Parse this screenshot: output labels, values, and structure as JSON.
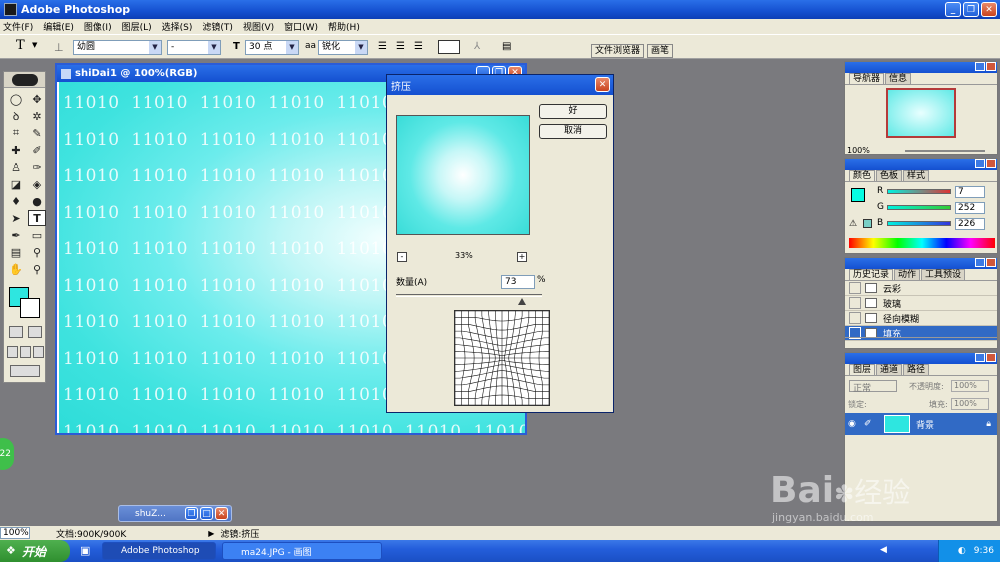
{
  "app": {
    "title": "Adobe Photoshop"
  },
  "menu": [
    "文件(F)",
    "编辑(E)",
    "图像(I)",
    "图层(L)",
    "选择(S)",
    "滤镜(T)",
    "视图(V)",
    "窗口(W)",
    "帮助(H)"
  ],
  "options": {
    "tool_icon": "T",
    "font_family": "幼圆",
    "font_style": "-",
    "font_size": "30 点",
    "antialias_label": "aa",
    "antialias": "锐化",
    "tab_file_browser": "文件浏览器",
    "tab_brushes": "画笔"
  },
  "document": {
    "title": "shiDai1 @ 100%(RGB)",
    "tile_text": "11010",
    "rows": 10,
    "cols": 7
  },
  "dialog": {
    "title": "挤压",
    "ok": "好",
    "cancel": "取消",
    "zoom": "33%",
    "minus": "-",
    "plus": "+",
    "amount_label": "数量(A)",
    "amount_value": "73",
    "amount_unit": "%"
  },
  "navigator": {
    "tabs": [
      "导航器",
      "信息"
    ],
    "zoom": "100%"
  },
  "color": {
    "tabs": [
      "颜色",
      "色板",
      "样式"
    ],
    "channels": [
      {
        "label": "R",
        "value": "7"
      },
      {
        "label": "G",
        "value": "252"
      },
      {
        "label": "B",
        "value": "226"
      }
    ],
    "fg_color": "#07fce2"
  },
  "history": {
    "tabs": [
      "历史记录",
      "动作",
      "工具预设"
    ],
    "items": [
      "云彩",
      "玻璃",
      "径向模糊",
      "填充"
    ]
  },
  "layers": {
    "tabs": [
      "图层",
      "通道",
      "路径"
    ],
    "blend_mode": "正常",
    "opacity_label": "不透明度:",
    "opacity": "100%",
    "lock_label": "锁定:",
    "fill_label": "填充:",
    "fill": "100%",
    "layer_name": "背景"
  },
  "minimized_doc": {
    "title": "shuZ..."
  },
  "status": {
    "zoom": "100%",
    "doc": "文档:900K/900K",
    "tool": "滤镜:挤压"
  },
  "taskbar": {
    "start": "开始",
    "tasks": [
      "Adobe Photoshop",
      "ma24.JPG - 画图"
    ],
    "clock": "9:36"
  },
  "side_badge": "22",
  "watermark": {
    "brand": "Bai",
    "brand2": "经验",
    "url": "jingyan.baidu.com"
  }
}
